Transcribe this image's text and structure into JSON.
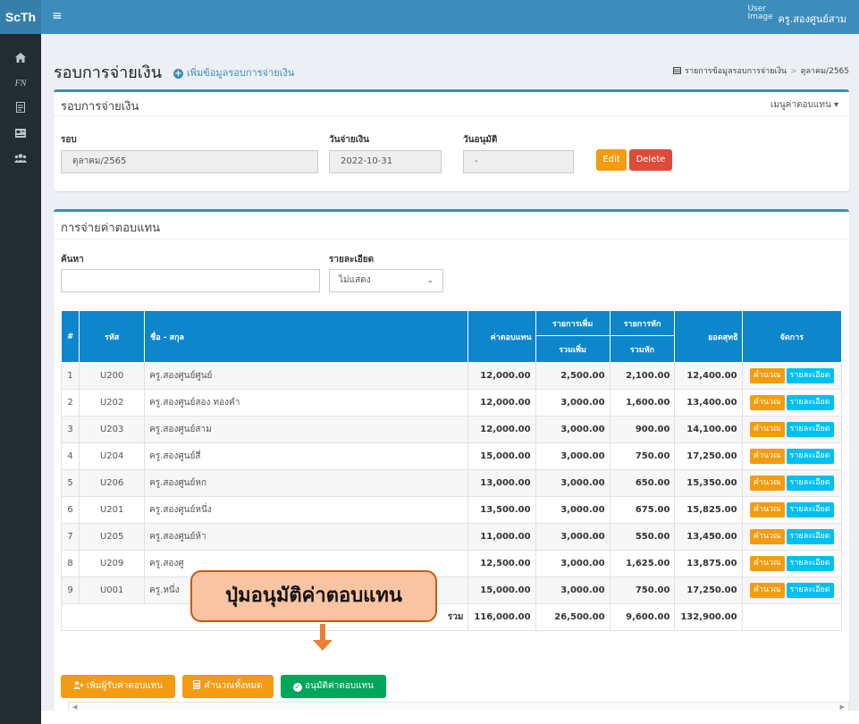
{
  "app": {
    "brand": "ScTh",
    "hamburger": "≡",
    "user_image_alt": "User Image",
    "user_name": "ครู.สองศูนย์สาม"
  },
  "sidebar": {
    "icons": [
      "home-icon",
      "fn-icon",
      "document-icon",
      "card-icon",
      "users-icon"
    ],
    "fn_label": "FN"
  },
  "page": {
    "title": "รอบการจ่ายเงิน",
    "add_link": "เพิ่มข้อมูลรอบการจ่ายเงิน",
    "breadcrumb": [
      "รายการข้อมูลรอบการจ่ายเงิน",
      "ตุลาคม/2565"
    ]
  },
  "round_box": {
    "title": "รอบการจ่ายเงิน",
    "menu": "เมนูค่าตอบแทน",
    "fields": {
      "round_label": "รอบ",
      "round_value": "ตุลาคม/2565",
      "pay_date_label": "วันจ่ายเงิน",
      "pay_date_value": "2022-10-31",
      "approve_date_label": "วันอนุมัติ",
      "approve_date_value": "-"
    },
    "edit": "Edit",
    "delete": "Delete"
  },
  "pay_box": {
    "title": "การจ่ายค่าตอบแทน",
    "search_label": "ค้นหา",
    "search_value": "",
    "detail_label": "รายละเอียด",
    "detail_value": "ไม่แสดง",
    "table": {
      "headers": {
        "no": "#",
        "code": "รหัส",
        "name": "ชื่อ - สกุล",
        "comp": "ค่าตอบแทน",
        "add_group": "รายการเพิ่ม",
        "add_sum": "รวมเพิ่ม",
        "ded_group": "รายการหัก",
        "ded_sum": "รวมหัก",
        "net": "ยอดสุทธิ",
        "manage": "จัดการ"
      },
      "rows": [
        {
          "no": "1",
          "code": "U200",
          "name": "ครู.สองศูนย์ศูนย์",
          "comp": "12,000.00",
          "add": "2,500.00",
          "ded": "2,100.00",
          "net": "12,400.00"
        },
        {
          "no": "2",
          "code": "U202",
          "name": "ครู.สองศูนย์สอง ทองคำ",
          "comp": "12,000.00",
          "add": "3,000.00",
          "ded": "1,600.00",
          "net": "13,400.00"
        },
        {
          "no": "3",
          "code": "U203",
          "name": "ครู.สองศูนย์สาม",
          "comp": "12,000.00",
          "add": "3,000.00",
          "ded": "900.00",
          "net": "14,100.00"
        },
        {
          "no": "4",
          "code": "U204",
          "name": "ครู.สองศูนย์สี่",
          "comp": "15,000.00",
          "add": "3,000.00",
          "ded": "750.00",
          "net": "17,250.00"
        },
        {
          "no": "5",
          "code": "U206",
          "name": "ครู.สองศูนย์หก",
          "comp": "13,000.00",
          "add": "3,000.00",
          "ded": "650.00",
          "net": "15,350.00"
        },
        {
          "no": "6",
          "code": "U201",
          "name": "ครู.สองศูนย์หนึ่ง",
          "comp": "13,500.00",
          "add": "3,000.00",
          "ded": "675.00",
          "net": "15,825.00"
        },
        {
          "no": "7",
          "code": "U205",
          "name": "ครู.สองศูนย์ห้า",
          "comp": "11,000.00",
          "add": "3,000.00",
          "ded": "550.00",
          "net": "13,450.00"
        },
        {
          "no": "8",
          "code": "U209",
          "name": "ครู.สองศู",
          "comp": "12,500.00",
          "add": "3,000.00",
          "ded": "1,625.00",
          "net": "13,875.00"
        },
        {
          "no": "9",
          "code": "U001",
          "name": "ครู.หนึ่ง",
          "comp": "15,000.00",
          "add": "3,000.00",
          "ded": "750.00",
          "net": "17,250.00"
        }
      ],
      "calc_label": "คำนวณ",
      "detail_btn_label": "รายละเอียด",
      "total": {
        "label": "รวม",
        "comp": "116,000.00",
        "add": "26,500.00",
        "ded": "9,600.00",
        "net": "132,900.00"
      }
    },
    "footer_buttons": {
      "add_recipient": "เพิ่มผู้รับค่าตอบแทน",
      "calc_all": "คำนวณทั้งหมด",
      "approve": "อนุมัติค่าตอบแทน"
    },
    "scroll_left": "◀",
    "scroll_right": "▶"
  },
  "annotation": {
    "callout": "ปุ่มอนุมัติค่าตอบแทน"
  },
  "colors": {
    "topbar": "#3c8dbc",
    "sidebar": "#222d32",
    "table_header": "#0d86cc",
    "edit": "#f39c12",
    "delete": "#dd4b39",
    "approve": "#00a65a",
    "callout_fill": "#f9c4a1",
    "arrow": "#ed7d31"
  }
}
